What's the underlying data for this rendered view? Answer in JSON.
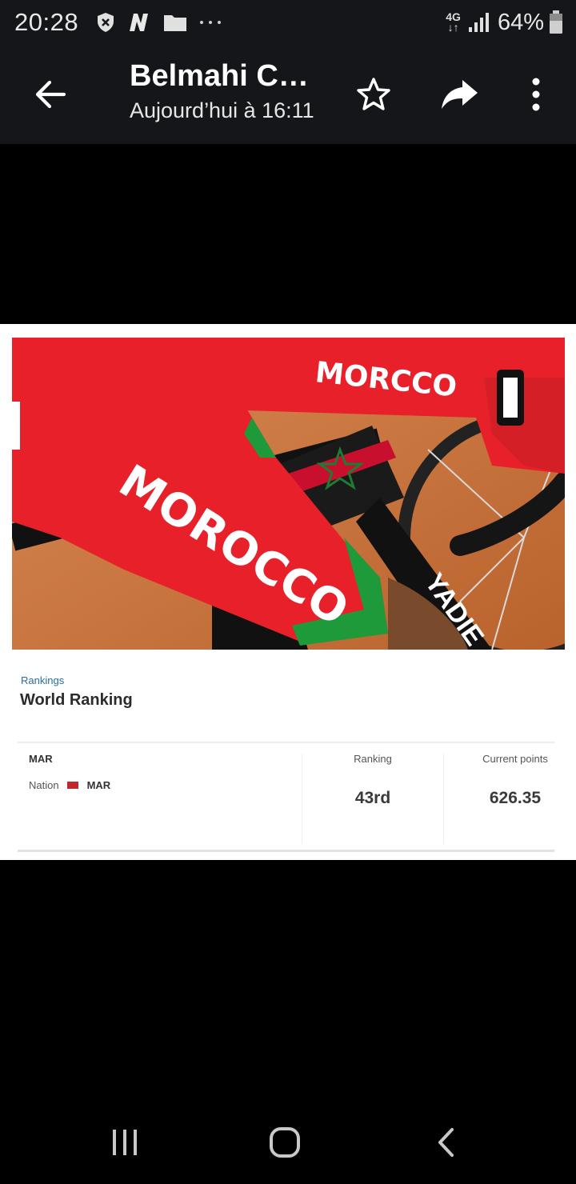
{
  "status_bar": {
    "time": "20:28",
    "network_type_top": "4G",
    "network_type_bottom": "↓↑",
    "battery_percent": "64%",
    "icons": [
      "shield-x-icon",
      "n-app-icon",
      "folder-icon",
      "more-dots-icon",
      "signal-icon",
      "battery-icon"
    ]
  },
  "app_bar": {
    "title": "Belmahi Cy…",
    "subtitle": "Aujourd’hui à 16:11",
    "icons": [
      "back-arrow-icon",
      "star-icon",
      "share-icon",
      "more-vert-icon"
    ]
  },
  "ranking_card": {
    "section_label": "Rankings",
    "heading": "World Ranking",
    "code": "MAR",
    "nation_label": "Nation",
    "nation_code": "MAR",
    "flag_color": "#c1272d",
    "ranking_header": "Ranking",
    "ranking_value": "43rd",
    "points_header": "Current points",
    "points_value": "626.35"
  },
  "photo": {
    "jersey_text_1": "MORCCO",
    "jersey_text_2": "MOROCCO",
    "frame_text": "YADIE"
  },
  "nav_bar": {
    "icons": [
      "recent-apps-icon",
      "home-icon",
      "back-nav-icon"
    ]
  },
  "colors": {
    "app_bar_bg": "#141619",
    "accent_link": "#2a6d9a",
    "jersey_red": "#e8202a",
    "jersey_green": "#1f9a3a"
  }
}
